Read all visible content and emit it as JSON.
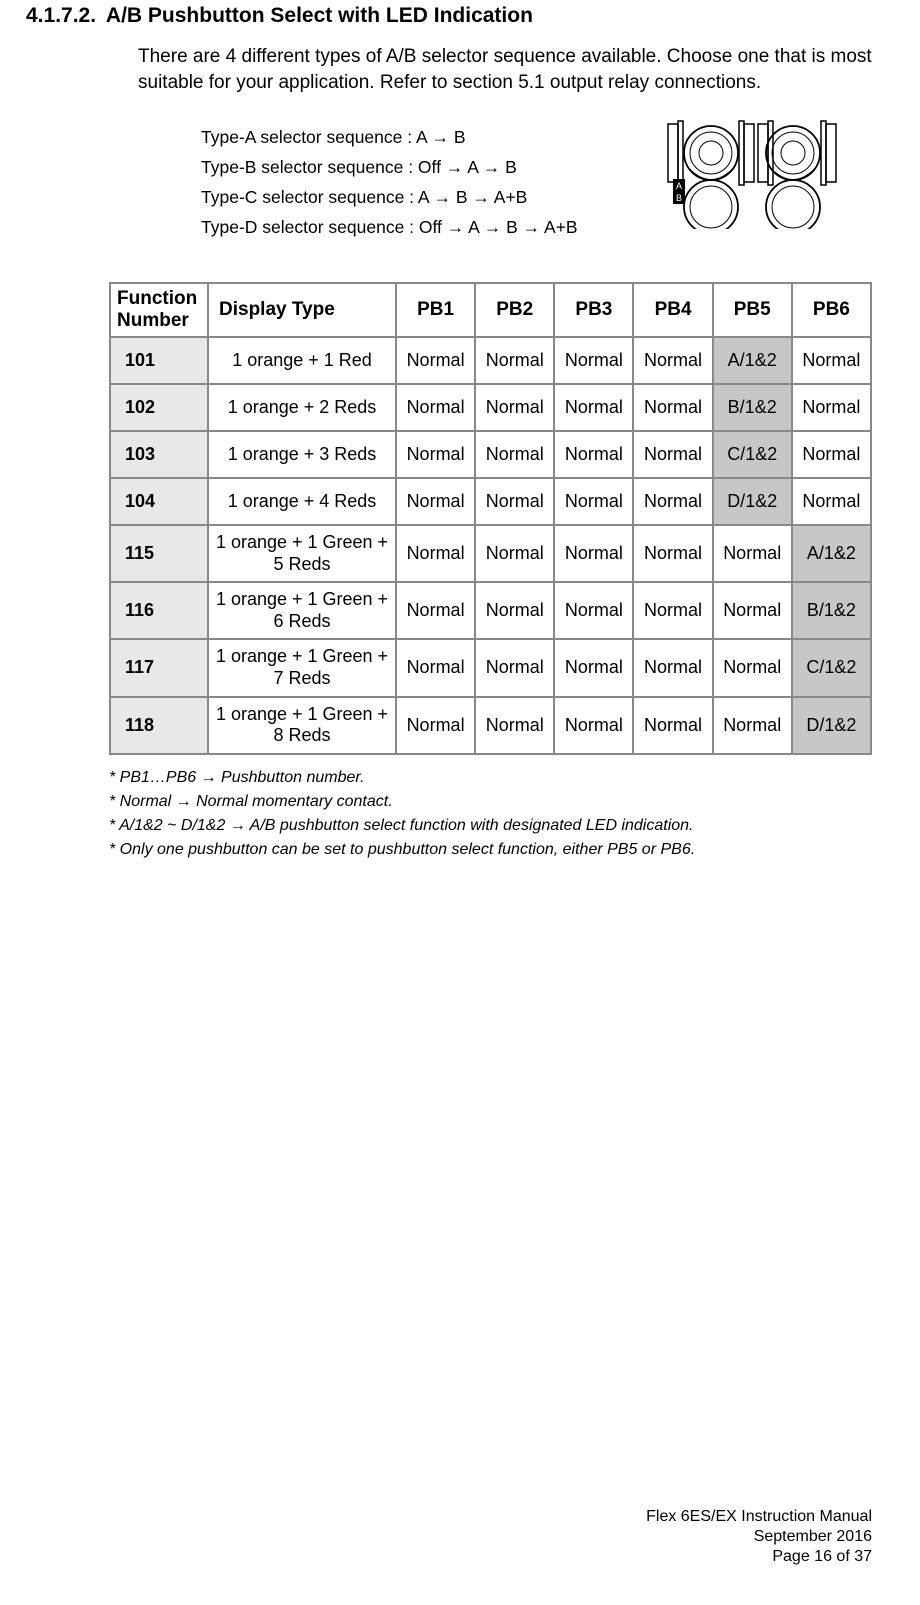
{
  "section": {
    "number": "4.1.7.2.",
    "heading": "A/B Pushbutton Select with LED Indication"
  },
  "intro": "There are 4 different types of A/B selector sequence available.  Choose one that is most suitable for your application.  Refer to section 5.1 output relay connections.",
  "sequences": [
    "Type-A selector sequence :  A → B",
    "Type-B selector sequence : Off → A → B",
    "Type-C selector sequence :  A → B → A+B",
    "Type-D selector sequence : Off → A → B → A+B"
  ],
  "table": {
    "headers": [
      "Function Number",
      "Display Type",
      "PB1",
      "PB2",
      "PB3",
      "PB4",
      "PB5",
      "PB6"
    ],
    "rows": [
      {
        "fn": "101",
        "dt": "1 orange + 1 Red",
        "pb": [
          "Normal",
          "Normal",
          "Normal",
          "Normal",
          "A/1&2",
          "Normal"
        ],
        "hl": 4
      },
      {
        "fn": "102",
        "dt": "1 orange + 2 Reds",
        "pb": [
          "Normal",
          "Normal",
          "Normal",
          "Normal",
          "B/1&2",
          "Normal"
        ],
        "hl": 4
      },
      {
        "fn": "103",
        "dt": "1 orange + 3 Reds",
        "pb": [
          "Normal",
          "Normal",
          "Normal",
          "Normal",
          "C/1&2",
          "Normal"
        ],
        "hl": 4
      },
      {
        "fn": "104",
        "dt": "1 orange + 4 Reds",
        "pb": [
          "Normal",
          "Normal",
          "Normal",
          "Normal",
          "D/1&2",
          "Normal"
        ],
        "hl": 4
      },
      {
        "fn": "115",
        "dt": "1 orange + 1 Green + 5 Reds",
        "pb": [
          "Normal",
          "Normal",
          "Normal",
          "Normal",
          "Normal",
          "A/1&2"
        ],
        "hl": 5
      },
      {
        "fn": "116",
        "dt": "1 orange + 1 Green + 6 Reds",
        "pb": [
          "Normal",
          "Normal",
          "Normal",
          "Normal",
          "Normal",
          "B/1&2"
        ],
        "hl": 5
      },
      {
        "fn": "117",
        "dt": "1 orange + 1 Green + 7 Reds",
        "pb": [
          "Normal",
          "Normal",
          "Normal",
          "Normal",
          "Normal",
          "C/1&2"
        ],
        "hl": 5
      },
      {
        "fn": "118",
        "dt": "1 orange + 1 Green + 8 Reds",
        "pb": [
          "Normal",
          "Normal",
          "Normal",
          "Normal",
          "Normal",
          "D/1&2"
        ],
        "hl": 5
      }
    ]
  },
  "footnotes": [
    "* PB1…PB6 → Pushbutton number.",
    "* Normal → Normal momentary contact.",
    "* A/1&2 ~ D/1&2 → A/B pushbutton select function with designated LED indication.",
    "* Only one pushbutton can be set to pushbutton select function, either PB5 or PB6."
  ],
  "footer": {
    "manual": "Flex 6ES/EX Instruction Manual",
    "date": "September 2016",
    "page": "Page 16 of 37"
  }
}
